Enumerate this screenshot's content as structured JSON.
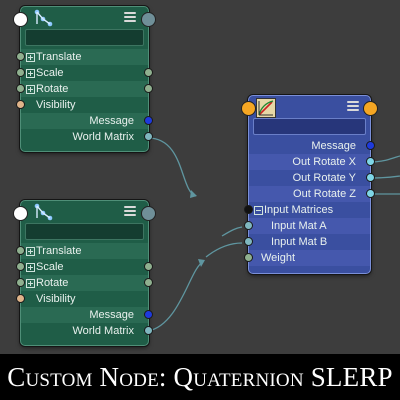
{
  "colors": {
    "canvas": "#3d3d3d",
    "green_node": "#1f5d47",
    "blue_node": "#3a4fa0",
    "wire": "#5f96a0",
    "plug_blue": "#1e3adc",
    "plug_cyan": "#7fd6e6",
    "header_dot_orange": "#f5a623",
    "header_dot_white": "#ffffff"
  },
  "node1": {
    "header_icon": "joint-icon",
    "name": "",
    "attrs": [
      {
        "label": "Translate",
        "expandable": true
      },
      {
        "label": "Scale",
        "expandable": true
      },
      {
        "label": "Rotate",
        "expandable": true
      },
      {
        "label": "Visibility",
        "expandable": false
      }
    ],
    "outputs": [
      "Message",
      "World Matrix"
    ]
  },
  "node2": {
    "header_icon": "joint-icon",
    "name": "",
    "attrs": [
      {
        "label": "Translate",
        "expandable": true
      },
      {
        "label": "Scale",
        "expandable": true
      },
      {
        "label": "Rotate",
        "expandable": true
      },
      {
        "label": "Visibility",
        "expandable": false
      }
    ],
    "outputs": [
      "Message",
      "World Matrix"
    ]
  },
  "node3": {
    "header_icon": "quaternion-slerp-icon",
    "name": "",
    "outputs": [
      "Message",
      "Out Rotate X",
      "Out Rotate Y",
      "Out Rotate Z"
    ],
    "group_label": "Input Matrices",
    "inputs": [
      "Input Mat A",
      "Input Mat B"
    ],
    "weight_label": "Weight"
  },
  "banner": {
    "text": "Custom Node: Quaternion SLERP"
  }
}
